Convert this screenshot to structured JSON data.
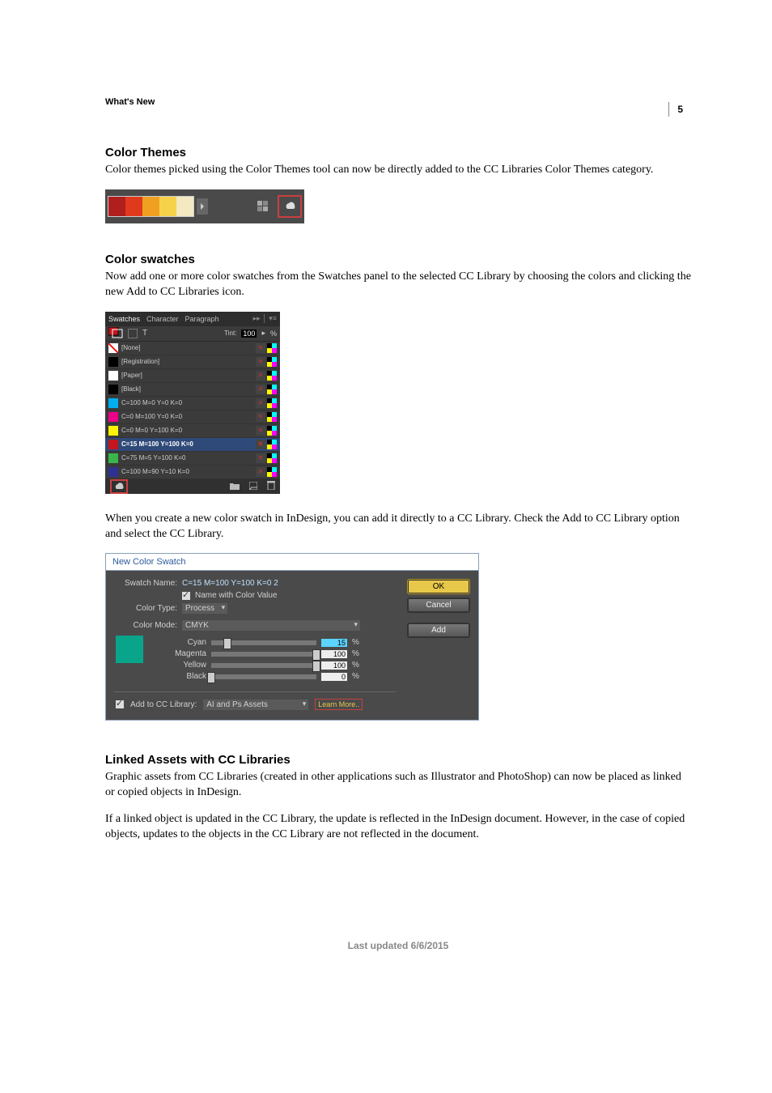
{
  "page_number": "5",
  "chapter_label": "What's New",
  "sections": {
    "color_themes": {
      "heading": "Color Themes",
      "para": "Color themes picked using the Color Themes tool can now be directly added to the CC Libraries Color Themes category."
    },
    "color_swatches": {
      "heading": "Color swatches",
      "para1": "Now add one or more color swatches from the Swatches panel to the selected CC Library by choosing the colors and clicking the new Add to CC Libraries icon.",
      "para2": "When you create a new color swatch in InDesign, you can add it directly to a CC Library. Check the Add to CC Library option and select the CC Library."
    },
    "linked_assets": {
      "heading": "Linked Assets with CC Libraries",
      "para1": "Graphic assets from CC Libraries (created in other applications such as Illustrator and PhotoShop) can now be placed as linked or copied objects in InDesign.",
      "para2": "If a linked object is updated in the CC Library, the update is reflected in the InDesign document. However, in the case of copied objects, updates to the objects in the CC Library are not reflected in the document."
    }
  },
  "themebar": {
    "swatches": [
      "#b01e1e",
      "#e03a1e",
      "#f0a020",
      "#f6d24a",
      "#f4e9c0"
    ]
  },
  "swatches_panel": {
    "tabs": [
      "Swatches",
      "Character",
      "Paragraph"
    ],
    "tint_label": "Tint:",
    "tint_value": "100",
    "tint_pct": "%",
    "rows": [
      {
        "name": "[None]",
        "color": "#ffffff",
        "none": true
      },
      {
        "name": "[Registration]",
        "color": "#000000"
      },
      {
        "name": "[Paper]",
        "color": "#ffffff"
      },
      {
        "name": "[Black]",
        "color": "#000000"
      },
      {
        "name": "C=100 M=0 Y=0 K=0",
        "color": "#00aeef"
      },
      {
        "name": "C=0 M=100 Y=0 K=0",
        "color": "#ec008c"
      },
      {
        "name": "C=0 M=0 Y=100 K=0",
        "color": "#fff200"
      },
      {
        "name": "C=15 M=100 Y=100 K=0",
        "color": "#c4161c",
        "selected": true
      },
      {
        "name": "C=75 M=5 Y=100 K=0",
        "color": "#39b54a"
      },
      {
        "name": "C=100 M=90 Y=10 K=0",
        "color": "#2e3192"
      }
    ]
  },
  "new_swatch_dialog": {
    "title": "New Color Swatch",
    "swatch_name_label": "Swatch Name:",
    "swatch_name_value": "C=15 M=100 Y=100 K=0 2",
    "name_with_color_value": "Name with Color Value",
    "color_type_label": "Color Type:",
    "color_type_value": "Process",
    "color_mode_label": "Color Mode:",
    "color_mode_value": "CMYK",
    "sliders": {
      "cyan": {
        "label": "Cyan",
        "value": "15"
      },
      "magenta": {
        "label": "Magenta",
        "value": "100"
      },
      "yellow": {
        "label": "Yellow",
        "value": "100"
      },
      "black": {
        "label": "Black",
        "value": "0"
      }
    },
    "pct": "%",
    "add_to_cc_label": "Add to CC Library:",
    "cc_lib_value": "AI and Ps Assets",
    "learn_more": "Learn More..",
    "buttons": {
      "ok": "OK",
      "cancel": "Cancel",
      "add": "Add"
    }
  },
  "footer": "Last updated 6/6/2015"
}
